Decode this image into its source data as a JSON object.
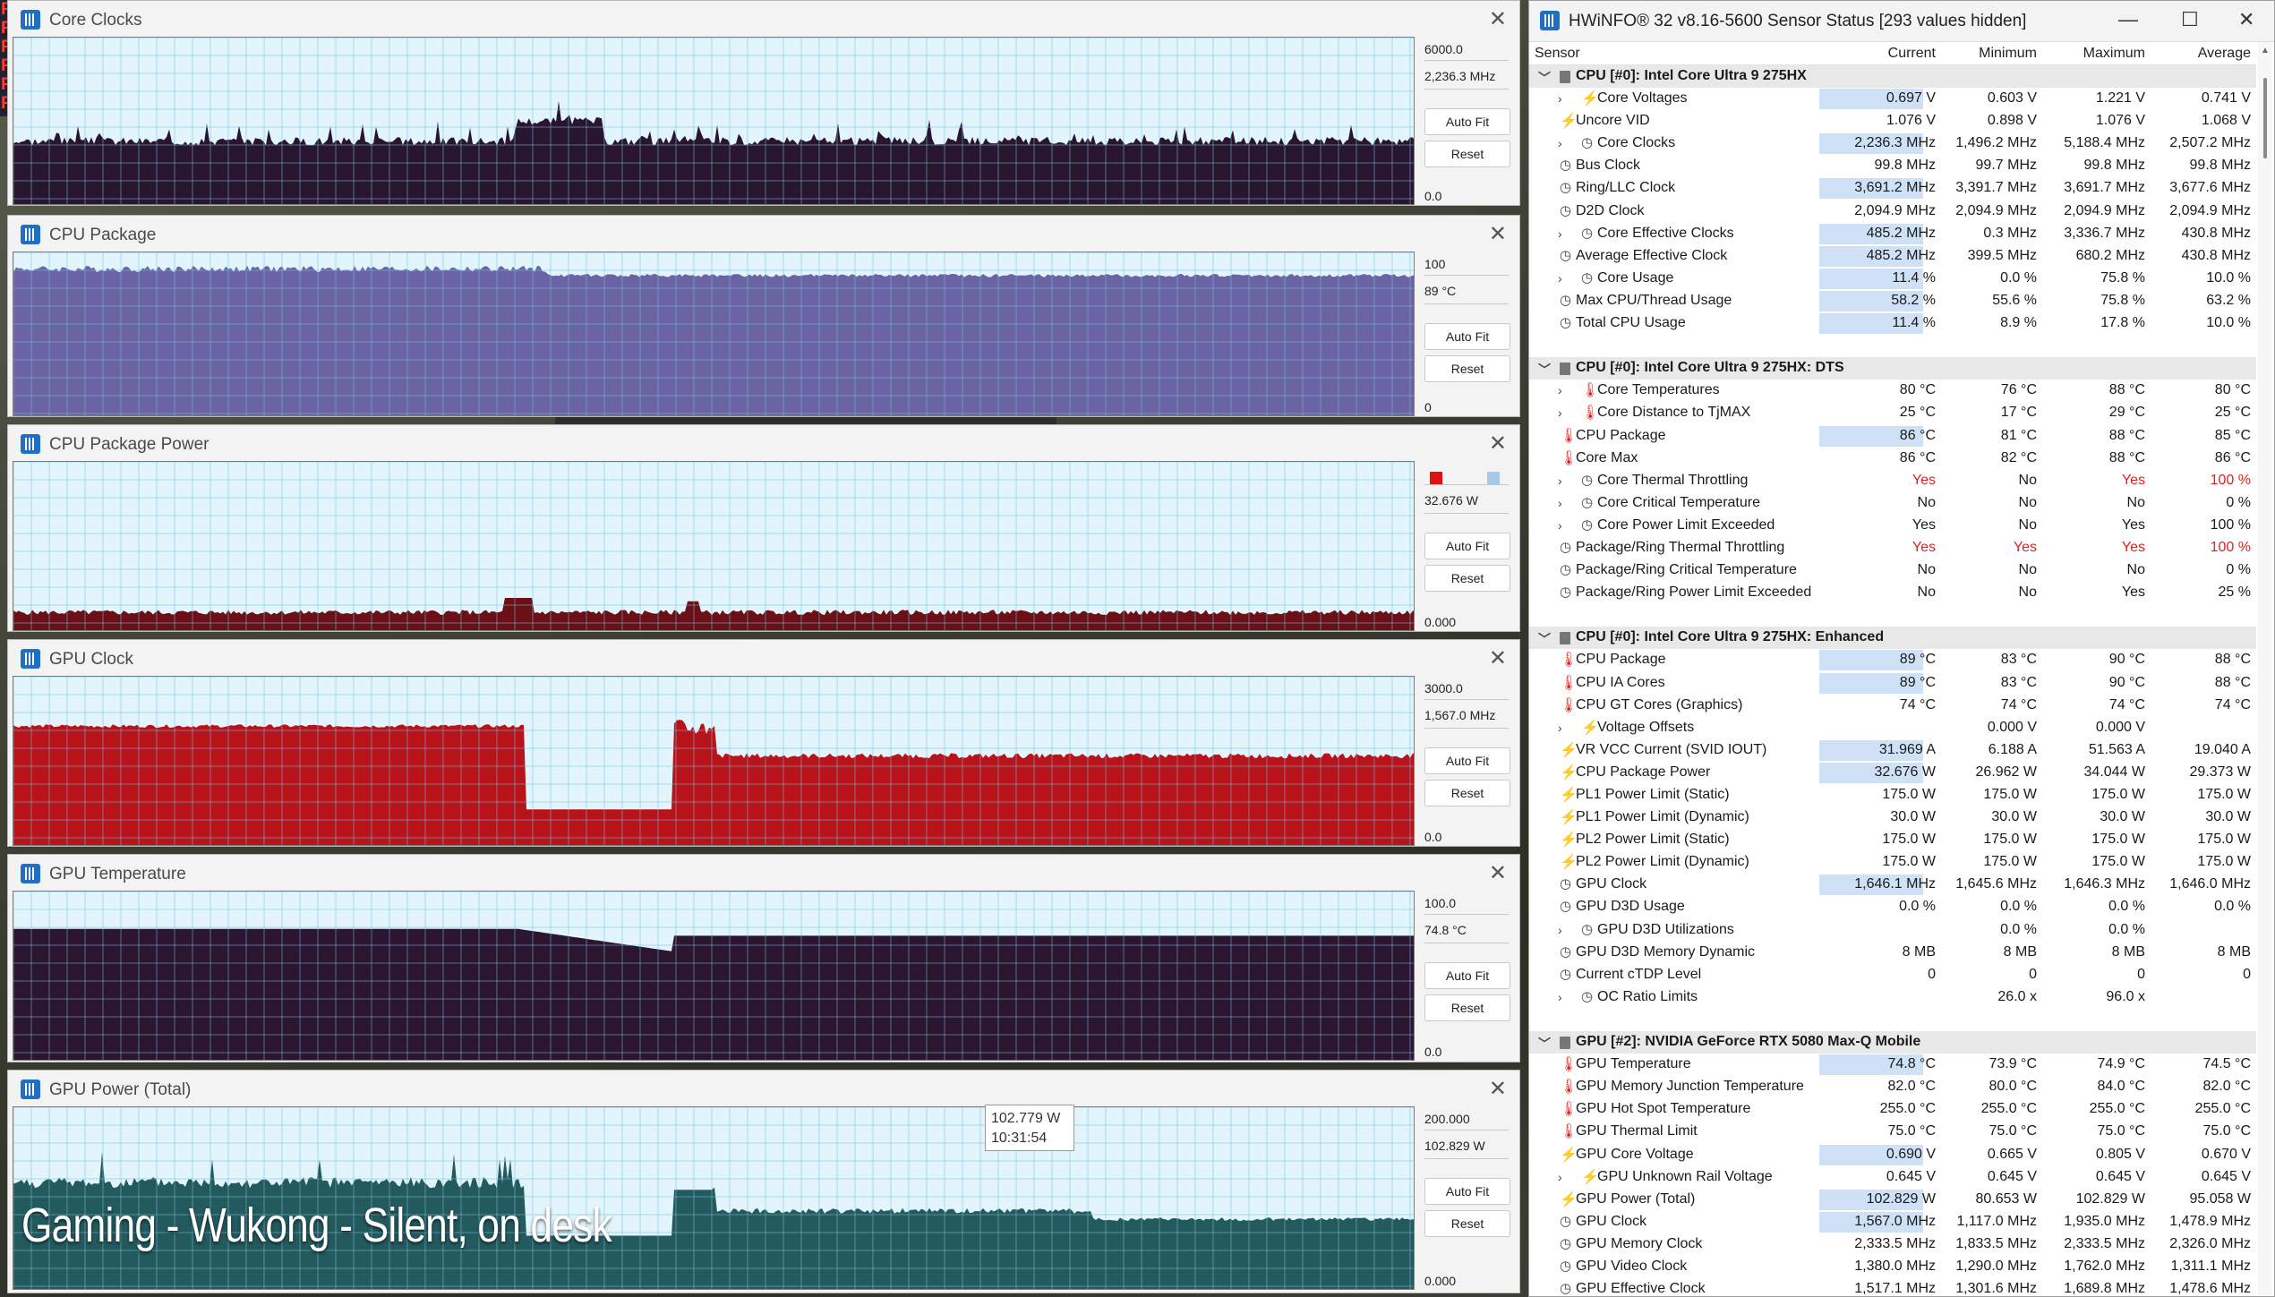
{
  "overlay": {
    "caption": "Gaming - Wukong - Silent, on desk",
    "tooltip_value": "102.779 W",
    "tooltip_time": "10:31:54"
  },
  "buttons": {
    "auto_fit": "Auto Fit",
    "reset": "Reset"
  },
  "graphs": [
    {
      "title": "Core Clocks",
      "max": "6000.0",
      "current": "2,236.3 MHz",
      "min": "0.0",
      "fill": "#2a1530",
      "bg": "#e2f5fc"
    },
    {
      "title": "CPU Package",
      "max": "100",
      "current": "89 °C",
      "min": "0",
      "fill": "#6a64a4",
      "bg": "#e2f5fc"
    },
    {
      "title": "CPU Package Power",
      "max": "",
      "current": "32.676 W",
      "min": "0.000",
      "fill": "#6a1016",
      "bg": "#e2f5fc"
    },
    {
      "title": "GPU Clock",
      "max": "3000.0",
      "current": "1,567.0 MHz",
      "min": "0.0",
      "fill": "#b8121a",
      "bg": "#e2f5fc"
    },
    {
      "title": "GPU Temperature",
      "max": "100.0",
      "current": "74.8 °C",
      "min": "0.0",
      "fill": "#2c1530",
      "bg": "#e2f5fc"
    },
    {
      "title": "GPU Power (Total)",
      "max": "200.000",
      "current": "102.829 W",
      "min": "0.000",
      "fill": "#235a5e",
      "bg": "#e2f5fc"
    }
  ],
  "hwinfo": {
    "title": "HWiNFO® 32 v8.16-5600 Sensor Status [293 values hidden]",
    "columns": {
      "sensor": "Sensor",
      "current": "Current",
      "minimum": "Minimum",
      "maximum": "Maximum",
      "average": "Average"
    },
    "rows": [
      {
        "t": "group",
        "name": "CPU [#0]: Intel Core Ultra 9 275HX"
      },
      {
        "t": "row",
        "exp": true,
        "icon": "bolt",
        "name": "Core Voltages",
        "cur": "0.697 V",
        "min": "0.603 V",
        "max": "1.221 V",
        "avg": "0.741 V",
        "hl": true
      },
      {
        "t": "row",
        "icon": "bolt",
        "name": "Uncore VID",
        "cur": "1.076 V",
        "min": "0.898 V",
        "max": "1.076 V",
        "avg": "1.068 V"
      },
      {
        "t": "row",
        "exp": true,
        "icon": "clock",
        "name": "Core Clocks",
        "cur": "2,236.3 MHz",
        "min": "1,496.2 MHz",
        "max": "5,188.4 MHz",
        "avg": "2,507.2 MHz",
        "hl": true
      },
      {
        "t": "row",
        "icon": "clock",
        "name": "Bus Clock",
        "cur": "99.8 MHz",
        "min": "99.7 MHz",
        "max": "99.8 MHz",
        "avg": "99.8 MHz"
      },
      {
        "t": "row",
        "icon": "clock",
        "name": "Ring/LLC Clock",
        "cur": "3,691.2 MHz",
        "min": "3,391.7 MHz",
        "max": "3,691.7 MHz",
        "avg": "3,677.6 MHz",
        "hl": true
      },
      {
        "t": "row",
        "icon": "clock",
        "name": "D2D Clock",
        "cur": "2,094.9 MHz",
        "min": "2,094.9 MHz",
        "max": "2,094.9 MHz",
        "avg": "2,094.9 MHz"
      },
      {
        "t": "row",
        "exp": true,
        "icon": "clock",
        "name": "Core Effective Clocks",
        "cur": "485.2 MHz",
        "min": "0.3 MHz",
        "max": "3,336.7 MHz",
        "avg": "430.8 MHz",
        "hl": true
      },
      {
        "t": "row",
        "icon": "clock",
        "name": "Average Effective Clock",
        "cur": "485.2 MHz",
        "min": "399.5 MHz",
        "max": "680.2 MHz",
        "avg": "430.8 MHz",
        "hl": true
      },
      {
        "t": "row",
        "exp": true,
        "icon": "clock",
        "name": "Core Usage",
        "cur": "11.4 %",
        "min": "0.0 %",
        "max": "75.8 %",
        "avg": "10.0 %",
        "hl": true
      },
      {
        "t": "row",
        "icon": "clock",
        "name": "Max CPU/Thread Usage",
        "cur": "58.2 %",
        "min": "55.6 %",
        "max": "75.8 %",
        "avg": "63.2 %",
        "hl": true
      },
      {
        "t": "row",
        "icon": "clock",
        "name": "Total CPU Usage",
        "cur": "11.4 %",
        "min": "8.9 %",
        "max": "17.8 %",
        "avg": "10.0 %",
        "hl": true
      },
      {
        "t": "gap"
      },
      {
        "t": "group",
        "name": "CPU [#0]: Intel Core Ultra 9 275HX: DTS"
      },
      {
        "t": "row",
        "exp": true,
        "icon": "therm",
        "name": "Core Temperatures",
        "cur": "80 °C",
        "min": "76 °C",
        "max": "88 °C",
        "avg": "80 °C"
      },
      {
        "t": "row",
        "exp": true,
        "icon": "therm",
        "name": "Core Distance to TjMAX",
        "cur": "25 °C",
        "min": "17 °C",
        "max": "29 °C",
        "avg": "25 °C"
      },
      {
        "t": "row",
        "icon": "therm",
        "name": "CPU Package",
        "cur": "86 °C",
        "min": "81 °C",
        "max": "88 °C",
        "avg": "85 °C",
        "hl": true
      },
      {
        "t": "row",
        "icon": "therm",
        "name": "Core Max",
        "cur": "86 °C",
        "min": "82 °C",
        "max": "88 °C",
        "avg": "86 °C"
      },
      {
        "t": "row",
        "exp": true,
        "icon": "clock",
        "name": "Core Thermal Throttling",
        "cur": "Yes",
        "min": "No",
        "max": "Yes",
        "avg": "100 %",
        "red": [
          "cur",
          "max",
          "avg"
        ]
      },
      {
        "t": "row",
        "exp": true,
        "icon": "clock",
        "name": "Core Critical Temperature",
        "cur": "No",
        "min": "No",
        "max": "No",
        "avg": "0 %"
      },
      {
        "t": "row",
        "exp": true,
        "icon": "clock",
        "name": "Core Power Limit Exceeded",
        "cur": "Yes",
        "min": "No",
        "max": "Yes",
        "avg": "100 %"
      },
      {
        "t": "row",
        "icon": "clock",
        "name": "Package/Ring Thermal Throttling",
        "cur": "Yes",
        "min": "Yes",
        "max": "Yes",
        "avg": "100 %",
        "red": [
          "cur",
          "min",
          "max",
          "avg"
        ]
      },
      {
        "t": "row",
        "icon": "clock",
        "name": "Package/Ring Critical Temperature",
        "cur": "No",
        "min": "No",
        "max": "No",
        "avg": "0 %"
      },
      {
        "t": "row",
        "icon": "clock",
        "name": "Package/Ring Power Limit Exceeded",
        "cur": "No",
        "min": "No",
        "max": "Yes",
        "avg": "25 %"
      },
      {
        "t": "gap"
      },
      {
        "t": "group",
        "name": "CPU [#0]: Intel Core Ultra 9 275HX: Enhanced"
      },
      {
        "t": "row",
        "icon": "therm",
        "name": "CPU Package",
        "cur": "89 °C",
        "min": "83 °C",
        "max": "90 °C",
        "avg": "88 °C",
        "hl": true
      },
      {
        "t": "row",
        "icon": "therm",
        "name": "CPU IA Cores",
        "cur": "89 °C",
        "min": "83 °C",
        "max": "90 °C",
        "avg": "88 °C",
        "hl": true
      },
      {
        "t": "row",
        "icon": "therm",
        "name": "CPU GT Cores (Graphics)",
        "cur": "74 °C",
        "min": "74 °C",
        "max": "74 °C",
        "avg": "74 °C"
      },
      {
        "t": "row",
        "exp": true,
        "icon": "bolt",
        "name": "Voltage Offsets",
        "cur": "",
        "min": "0.000 V",
        "max": "0.000 V",
        "avg": ""
      },
      {
        "t": "row",
        "icon": "bolt",
        "name": "VR VCC Current (SVID IOUT)",
        "cur": "31.969 A",
        "min": "6.188 A",
        "max": "51.563 A",
        "avg": "19.040 A",
        "hl": true
      },
      {
        "t": "row",
        "icon": "bolt",
        "name": "CPU Package Power",
        "cur": "32.676 W",
        "min": "26.962 W",
        "max": "34.044 W",
        "avg": "29.373 W",
        "hl": true
      },
      {
        "t": "row",
        "icon": "bolt",
        "name": "PL1 Power Limit (Static)",
        "cur": "175.0 W",
        "min": "175.0 W",
        "max": "175.0 W",
        "avg": "175.0 W"
      },
      {
        "t": "row",
        "icon": "bolt",
        "name": "PL1 Power Limit (Dynamic)",
        "cur": "30.0 W",
        "min": "30.0 W",
        "max": "30.0 W",
        "avg": "30.0 W"
      },
      {
        "t": "row",
        "icon": "bolt",
        "name": "PL2 Power Limit (Static)",
        "cur": "175.0 W",
        "min": "175.0 W",
        "max": "175.0 W",
        "avg": "175.0 W"
      },
      {
        "t": "row",
        "icon": "bolt",
        "name": "PL2 Power Limit (Dynamic)",
        "cur": "175.0 W",
        "min": "175.0 W",
        "max": "175.0 W",
        "avg": "175.0 W"
      },
      {
        "t": "row",
        "icon": "clock",
        "name": "GPU Clock",
        "cur": "1,646.1 MHz",
        "min": "1,645.6 MHz",
        "max": "1,646.3 MHz",
        "avg": "1,646.0 MHz",
        "hl": true
      },
      {
        "t": "row",
        "icon": "clock",
        "name": "GPU D3D Usage",
        "cur": "0.0 %",
        "min": "0.0 %",
        "max": "0.0 %",
        "avg": "0.0 %"
      },
      {
        "t": "row",
        "exp": true,
        "icon": "clock",
        "name": "GPU D3D Utilizations",
        "cur": "",
        "min": "0.0 %",
        "max": "0.0 %",
        "avg": ""
      },
      {
        "t": "row",
        "icon": "clock",
        "name": "GPU D3D Memory Dynamic",
        "cur": "8 MB",
        "min": "8 MB",
        "max": "8 MB",
        "avg": "8 MB"
      },
      {
        "t": "row",
        "icon": "clock",
        "name": "Current cTDP Level",
        "cur": "0",
        "min": "0",
        "max": "0",
        "avg": "0"
      },
      {
        "t": "row",
        "exp": true,
        "icon": "clock",
        "name": "OC Ratio Limits",
        "cur": "",
        "min": "26.0 x",
        "max": "96.0 x",
        "avg": ""
      },
      {
        "t": "gap"
      },
      {
        "t": "group",
        "name": "GPU [#2]: NVIDIA  GeForce RTX 5080 Max-Q Mobile"
      },
      {
        "t": "row",
        "icon": "therm",
        "name": "GPU Temperature",
        "cur": "74.8 °C",
        "min": "73.9 °C",
        "max": "74.9 °C",
        "avg": "74.5 °C",
        "hl": true
      },
      {
        "t": "row",
        "icon": "therm",
        "name": "GPU Memory Junction Temperature",
        "cur": "82.0 °C",
        "min": "80.0 °C",
        "max": "84.0 °C",
        "avg": "82.0 °C"
      },
      {
        "t": "row",
        "icon": "therm",
        "name": "GPU Hot Spot Temperature",
        "cur": "255.0 °C",
        "min": "255.0 °C",
        "max": "255.0 °C",
        "avg": "255.0 °C"
      },
      {
        "t": "row",
        "icon": "therm",
        "name": "GPU Thermal Limit",
        "cur": "75.0 °C",
        "min": "75.0 °C",
        "max": "75.0 °C",
        "avg": "75.0 °C"
      },
      {
        "t": "row",
        "icon": "bolt",
        "name": "GPU Core Voltage",
        "cur": "0.690 V",
        "min": "0.665 V",
        "max": "0.805 V",
        "avg": "0.670 V",
        "hl": true
      },
      {
        "t": "row",
        "exp": true,
        "icon": "bolt",
        "name": "GPU Unknown Rail Voltage",
        "cur": "0.645 V",
        "min": "0.645 V",
        "max": "0.645 V",
        "avg": "0.645 V"
      },
      {
        "t": "row",
        "icon": "bolt",
        "name": "GPU Power (Total)",
        "cur": "102.829 W",
        "min": "80.653 W",
        "max": "102.829 W",
        "avg": "95.058 W",
        "hl": true
      },
      {
        "t": "row",
        "icon": "clock",
        "name": "GPU Clock",
        "cur": "1,567.0 MHz",
        "min": "1,117.0 MHz",
        "max": "1,935.0 MHz",
        "avg": "1,478.9 MHz",
        "hl": true
      },
      {
        "t": "row",
        "icon": "clock",
        "name": "GPU Memory Clock",
        "cur": "2,333.5 MHz",
        "min": "1,833.5 MHz",
        "max": "2,333.5 MHz",
        "avg": "2,326.0 MHz"
      },
      {
        "t": "row",
        "icon": "clock",
        "name": "GPU Video Clock",
        "cur": "1,380.0 MHz",
        "min": "1,290.0 MHz",
        "max": "1,762.0 MHz",
        "avg": "1,311.1 MHz"
      },
      {
        "t": "row",
        "icon": "clock",
        "name": "GPU Effective Clock",
        "cur": "1,517.1 MHz",
        "min": "1,301.6 MHz",
        "max": "1,689.8 MHz",
        "avg": "1,478.6 MHz"
      }
    ]
  }
}
